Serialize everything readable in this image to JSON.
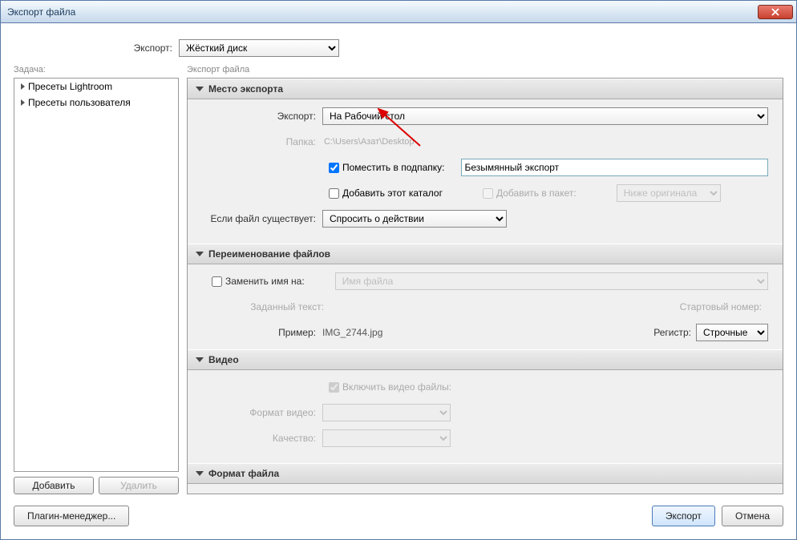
{
  "window": {
    "title": "Экспорт файла"
  },
  "top": {
    "export_label": "Экспорт:",
    "export_target": "Жёсткий диск"
  },
  "left": {
    "task_label": "Задача:",
    "presets": [
      "Пресеты Lightroom",
      "Пресеты пользователя"
    ],
    "add_btn": "Добавить",
    "remove_btn": "Удалить"
  },
  "right": {
    "pane_label": "Экспорт файла",
    "location": {
      "header": "Место экспорта",
      "export_label": "Экспорт:",
      "export_value": "На Рабочий стол",
      "folder_label": "Папка:",
      "folder_value": "C:\\Users\\Азат\\Desktop",
      "subfolder_chk": "Поместить в подпапку:",
      "subfolder_value": "Безымянный экспорт",
      "add_catalog_chk": "Добавить этот каталог",
      "add_stack_chk": "Добавить в пакет:",
      "stack_pos": "Ниже оригинала",
      "exists_label": "Если файл существует:",
      "exists_value": "Спросить о действии"
    },
    "rename": {
      "header": "Переименование файлов",
      "rename_chk": "Заменить имя на:",
      "template_value": "Имя файла",
      "custom_text_label": "Заданный текст:",
      "start_num_label": "Стартовый номер:",
      "example_label": "Пример:",
      "example_value": "IMG_2744.jpg",
      "case_label": "Регистр:",
      "case_value": "Строчные"
    },
    "video": {
      "header": "Видео",
      "include_chk": "Включить видео файлы:",
      "format_label": "Формат видео:",
      "quality_label": "Качество:"
    },
    "format": {
      "header": "Формат файла"
    }
  },
  "bottom": {
    "plugin_btn": "Плагин-менеджер...",
    "export_btn": "Экспорт",
    "cancel_btn": "Отмена"
  }
}
